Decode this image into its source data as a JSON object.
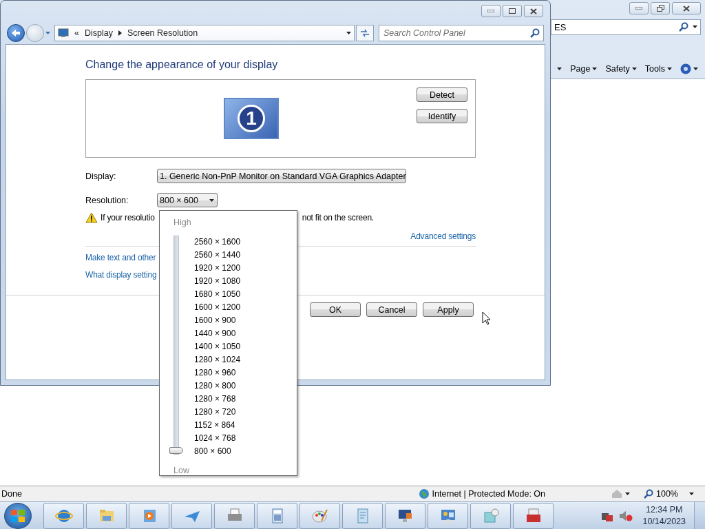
{
  "control_panel": {
    "breadcrumb_prefix": "«",
    "breadcrumb": [
      "Display",
      "Screen Resolution"
    ],
    "search": {
      "placeholder": "Search Control Panel"
    },
    "heading": "Change the appearance of your display",
    "monitor_number": "1",
    "side_buttons": [
      "Detect",
      "Identify"
    ],
    "display": {
      "label": "Display:",
      "value": "1. Generic Non-PnP Monitor on Standard VGA Graphics Adapter"
    },
    "resolution": {
      "label": "Resolution:",
      "value": "800 × 600"
    },
    "warning": [
      "If your resolutio",
      "not fit on the screen."
    ],
    "advanced_link": "Advanced settings",
    "links": [
      "Make text and other",
      "What display setting"
    ],
    "buttons": [
      "OK",
      "Cancel",
      "Apply"
    ],
    "resolution_menu": {
      "high_label": "High",
      "low_label": "Low",
      "level": 0,
      "options": [
        "2560 × 1600",
        "2560 × 1440",
        "1920 × 1200",
        "1920 × 1080",
        "1680 × 1050",
        "1600 × 1200",
        "1600 × 900",
        "1440 × 900",
        "1400 × 1050",
        "1280 × 1024",
        "1280 × 960",
        "1280 × 800",
        "1280 × 768",
        "1280 × 720",
        "1152 × 864",
        "1024 × 768",
        "800 × 600"
      ]
    }
  },
  "browser": {
    "address": "ES",
    "toolbar": [
      "Page",
      "Safety",
      "Tools"
    ],
    "status_bar": {
      "text": "Done",
      "zone": "Internet | Protected Mode: On",
      "zoom": "100%"
    }
  },
  "taskbar": {
    "time": "12:34 PM",
    "date": "10/14/2023"
  }
}
